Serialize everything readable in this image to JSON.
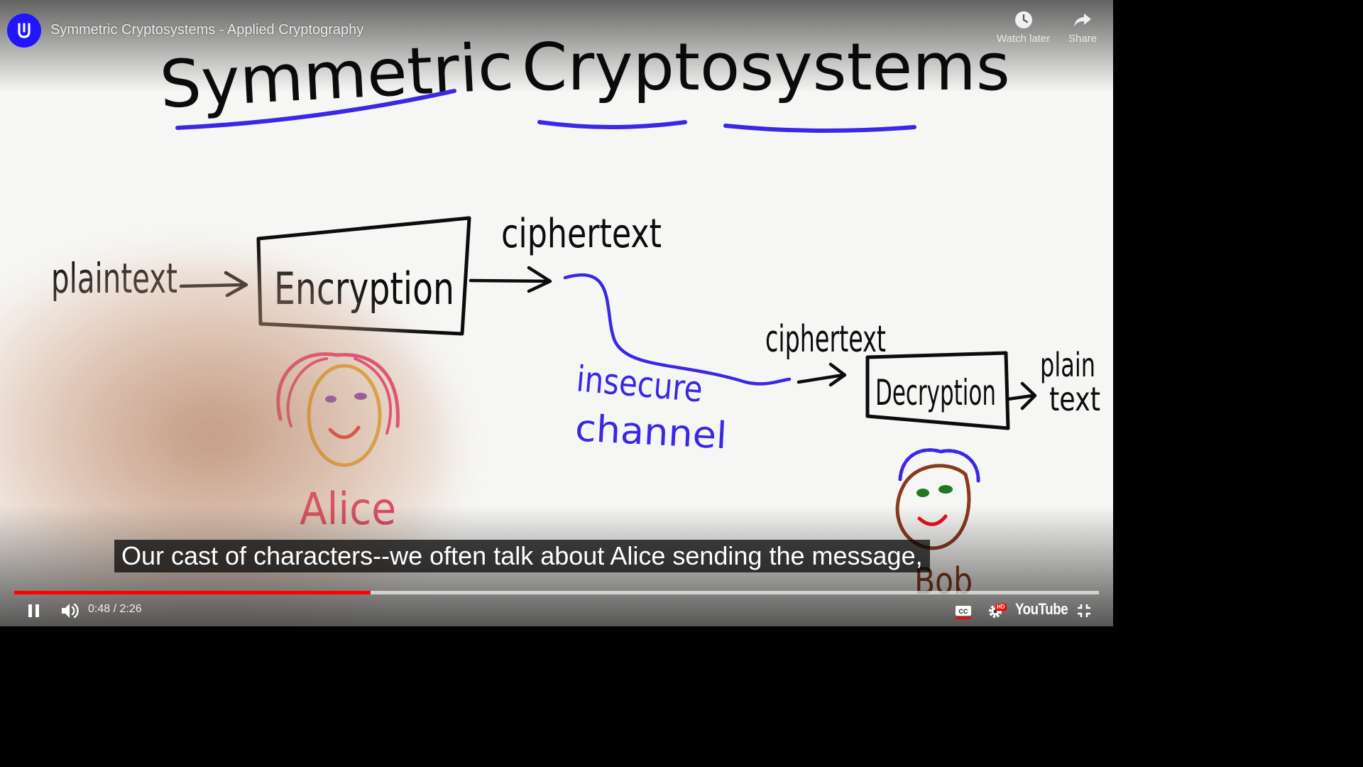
{
  "player": {
    "title": "Symmetric Cryptosystems - Applied Cryptography",
    "watch_later_label": "Watch later",
    "share_label": "Share",
    "caption": "Our cast of characters--we often talk about Alice sending the message,",
    "current_time": "0:48",
    "time_separator": " / ",
    "duration": "2:26",
    "progress_fraction": 0.3288,
    "loaded_fraction": 1.0,
    "brand_label": "YouTube",
    "hd_label": "HD",
    "cc_label": "CC",
    "colors": {
      "progress": "#ff0000",
      "avatar": "#2015ff",
      "ink_blue": "#3b27e6",
      "alice_hair": "#e8246a",
      "alice_face": "#e6a21a",
      "bob_face": "#8a3a1e",
      "bob_eyes": "#1f7a1f"
    }
  },
  "whiteboard": {
    "heading_word_1": "Symmetric",
    "heading_word_2": "Cryptosystems",
    "plaintext_in": "plaintext",
    "encryption_box": "Encryption",
    "ciphertext_1": "ciphertext",
    "insecure": "insecure",
    "channel": "channel",
    "ciphertext_2": "ciphertext",
    "decryption_box": "Decryption",
    "plain_out": "plain",
    "text_out": "text",
    "alice_label": "Alice",
    "bob_label": "Bob"
  }
}
